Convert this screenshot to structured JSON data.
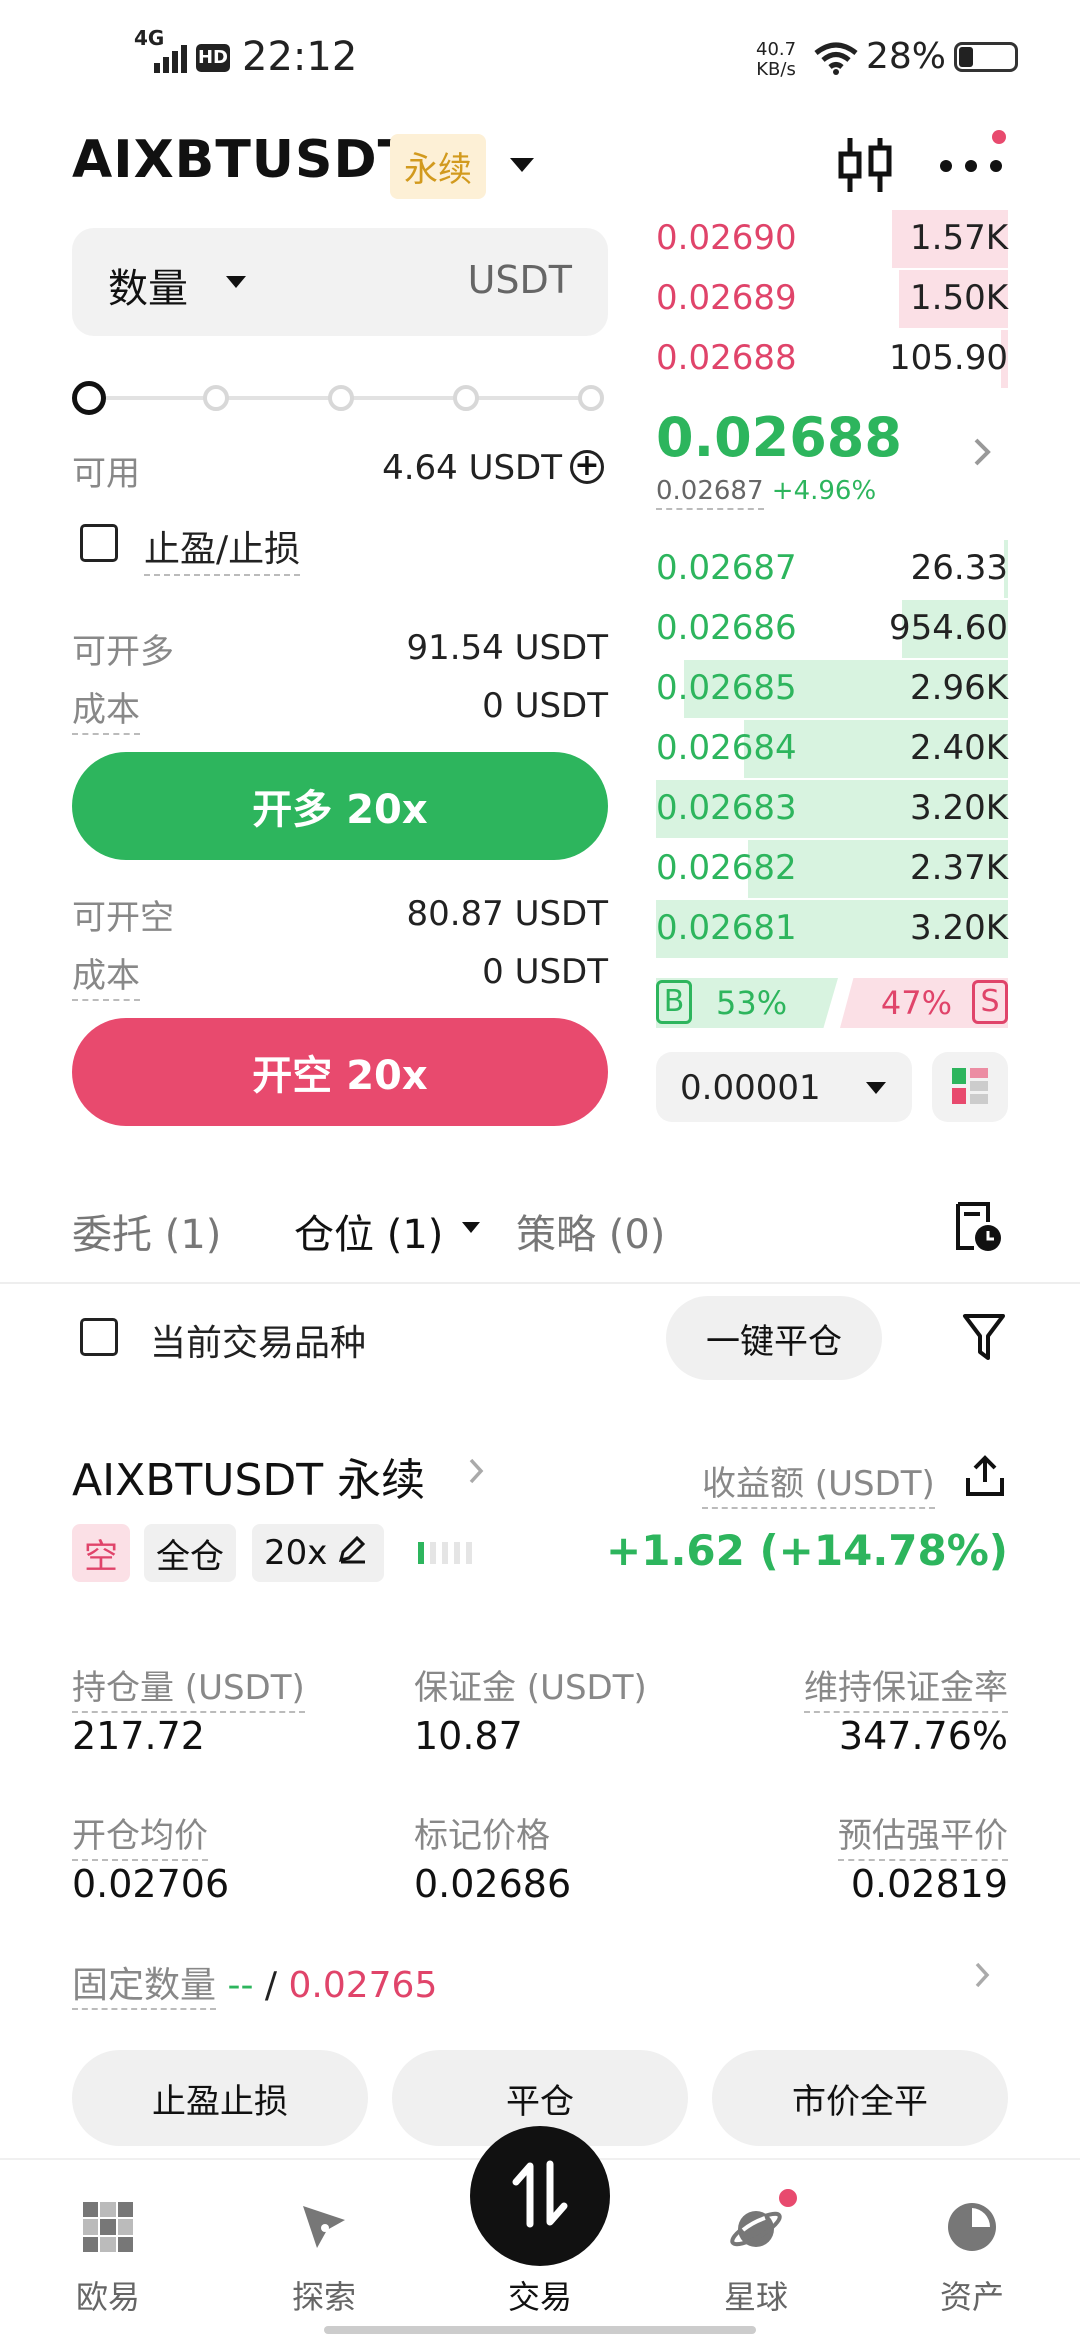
{
  "status_bar": {
    "network": "4G",
    "hd": "HD",
    "time": "22:12",
    "speed_top": "40.7",
    "speed_bottom": "KB/s",
    "battery": "28%"
  },
  "header": {
    "symbol": "AIXBTUSDT",
    "badge": "永续"
  },
  "order_form": {
    "qty_label": "数量",
    "qty_unit": "USDT",
    "available_label": "可用",
    "available_value": "4.64 USDT",
    "tp_sl_label": "止盈/止损",
    "long_max_label": "可开多",
    "long_max_value": "91.54 USDT",
    "long_cost_label": "成本",
    "long_cost_value": "0 USDT",
    "long_button": "开多 20x",
    "short_max_label": "可开空",
    "short_max_value": "80.87 USDT",
    "short_cost_label": "成本",
    "short_cost_value": "0 USDT",
    "short_button": "开空 20x"
  },
  "order_book": {
    "asks": [
      {
        "price": "0.02690",
        "qty": "1.57K",
        "depth": 0.33
      },
      {
        "price": "0.02689",
        "qty": "1.50K",
        "depth": 0.31
      },
      {
        "price": "0.02688",
        "qty": "105.90",
        "depth": 0.02
      }
    ],
    "last_price": "0.02688",
    "mark_price": "0.02687",
    "change": "+4.96%",
    "bids": [
      {
        "price": "0.02687",
        "qty": "26.33",
        "depth": 0.01
      },
      {
        "price": "0.02686",
        "qty": "954.60",
        "depth": 0.3
      },
      {
        "price": "0.02685",
        "qty": "2.96K",
        "depth": 0.92
      },
      {
        "price": "0.02684",
        "qty": "2.40K",
        "depth": 0.75
      },
      {
        "price": "0.02683",
        "qty": "3.20K",
        "depth": 1.0
      },
      {
        "price": "0.02682",
        "qty": "2.37K",
        "depth": 0.74
      },
      {
        "price": "0.02681",
        "qty": "3.20K",
        "depth": 1.0
      }
    ],
    "buy_tag": "B",
    "buy_pct": "53%",
    "sell_pct": "47%",
    "sell_tag": "S",
    "precision": "0.00001"
  },
  "tabs": [
    {
      "label": "委托 (1)"
    },
    {
      "label": "仓位 (1)"
    },
    {
      "label": "策略 (0)"
    }
  ],
  "filter": {
    "current_symbol_label": "当前交易品种",
    "close_all_button": "一键平仓"
  },
  "position": {
    "title": "AIXBTUSDT 永续",
    "pnl_label": "收益额 (USDT)",
    "side_chip": "空",
    "margin_mode_chip": "全仓",
    "leverage_chip": "20x",
    "pnl_value": "+1.62 (+14.78%)",
    "size_label": "持仓量 (USDT)",
    "size_value": "217.72",
    "margin_label": "保证金 (USDT)",
    "margin_value": "10.87",
    "mmr_label": "维持保证金率",
    "mmr_value": "347.76%",
    "entry_label": "开仓均价",
    "entry_value": "0.02706",
    "mark_label": "标记价格",
    "mark_value": "0.02686",
    "liq_label": "预估强平价",
    "liq_value": "0.02819",
    "fixed_label": "固定数量",
    "fixed_tp": "--",
    "fixed_sep": "/",
    "fixed_sl": "0.02765"
  },
  "actions": {
    "tp_sl": "止盈止损",
    "close": "平仓",
    "market_close": "市价全平"
  },
  "nav": [
    {
      "label": "欧易",
      "icon": "okx-logo-icon"
    },
    {
      "label": "探索",
      "icon": "compass-icon"
    },
    {
      "label": "交易",
      "icon": "trade-swap-icon"
    },
    {
      "label": "星球",
      "icon": "planet-icon"
    },
    {
      "label": "资产",
      "icon": "pie-chart-icon"
    }
  ]
}
